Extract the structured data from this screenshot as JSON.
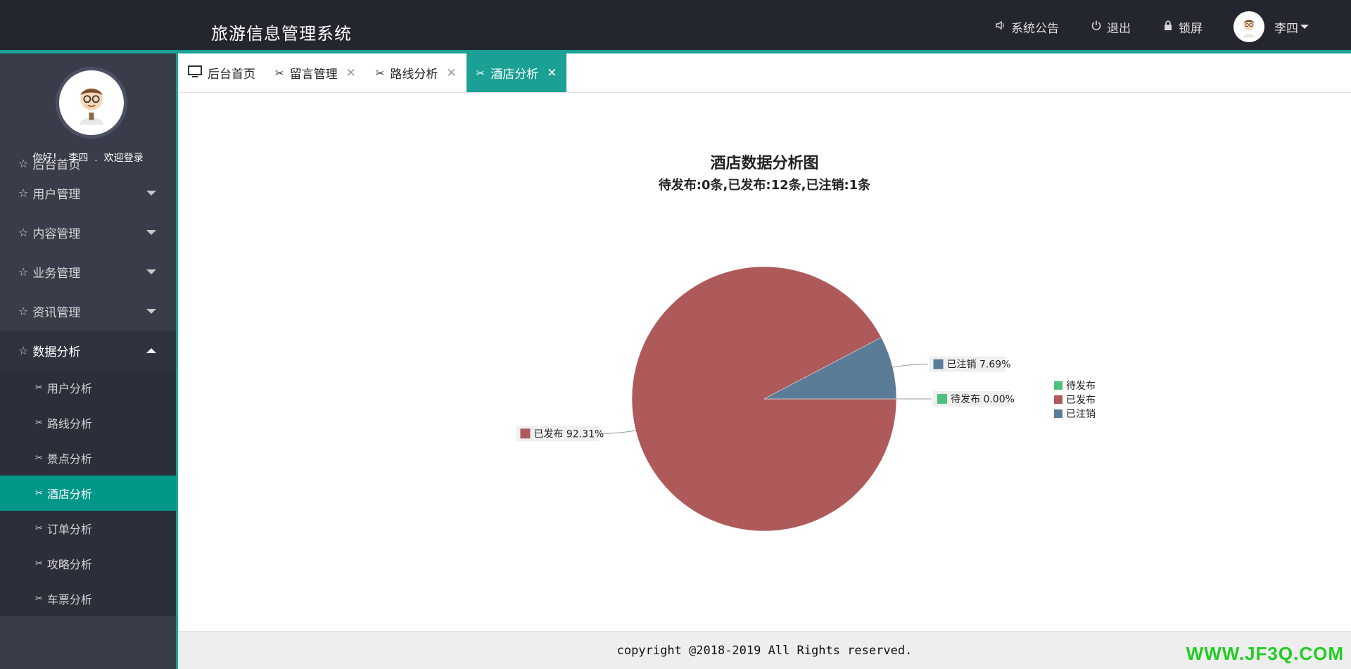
{
  "header": {
    "app_title": "旅游信息管理系统",
    "nav": [
      {
        "label": "系统公告",
        "icon": "speaker-icon"
      },
      {
        "label": "退出",
        "icon": "power-icon"
      },
      {
        "label": "锁屏",
        "icon": "lock-icon"
      }
    ],
    "user_name": "李四"
  },
  "sidebar": {
    "welcome": "你好！  李四  .  欢迎登录",
    "partial_item": "后台首页",
    "menu": [
      {
        "label": "用户管理",
        "expanded": false
      },
      {
        "label": "内容管理",
        "expanded": false
      },
      {
        "label": "业务管理",
        "expanded": false
      },
      {
        "label": "资讯管理",
        "expanded": false
      },
      {
        "label": "数据分析",
        "expanded": true
      }
    ],
    "submenu": [
      {
        "label": "用户分析",
        "active": false
      },
      {
        "label": "路线分析",
        "active": false
      },
      {
        "label": "景点分析",
        "active": false
      },
      {
        "label": "酒店分析",
        "active": true
      },
      {
        "label": "订单分析",
        "active": false
      },
      {
        "label": "攻略分析",
        "active": false
      },
      {
        "label": "车票分析",
        "active": false
      }
    ]
  },
  "tabs": [
    {
      "label": "后台首页",
      "icon": "monitor-icon",
      "closable": false,
      "active": false
    },
    {
      "label": "留言管理",
      "icon": "tools-icon",
      "closable": true,
      "active": false
    },
    {
      "label": "路线分析",
      "icon": "tools-icon",
      "closable": true,
      "active": false
    },
    {
      "label": "酒店分析",
      "icon": "tools-icon",
      "closable": true,
      "active": true
    }
  ],
  "chart_data": {
    "type": "pie",
    "title": "酒店数据分析图",
    "subtitle": "待发布:0条,已发布:12条,已注销:1条",
    "slices": [
      {
        "name": "待发布",
        "value": 0,
        "percent_label": "待发布 0.00%",
        "color": "#4cc17b"
      },
      {
        "name": "已发布",
        "value": 12,
        "percent_label": "已发布 92.31%",
        "color": "#ae5a5a"
      },
      {
        "name": "已注销",
        "value": 1,
        "percent_label": "已注销 7.69%",
        "color": "#5b7c96"
      }
    ],
    "legend": [
      "待发布",
      "已发布",
      "已注销"
    ],
    "legend_position": "right"
  },
  "footer": {
    "copyright": "copyright @2018-2019 All Rights reserved."
  },
  "watermark": "WWW.JF3Q.COM"
}
